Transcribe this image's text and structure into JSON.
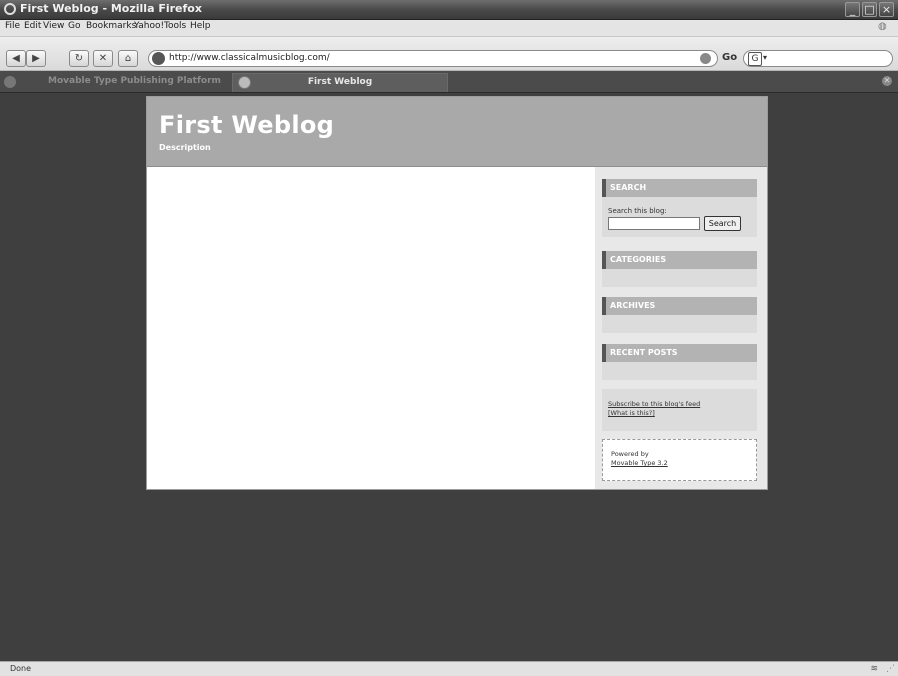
{
  "window": {
    "title": "First Weblog - Mozilla Firefox"
  },
  "menu": [
    "File",
    "Edit",
    "View",
    "Go",
    "Bookmarks",
    "Yahoo!",
    "Tools",
    "Help"
  ],
  "nav": {
    "url": "http://www.classicalmusicblog.com/",
    "go_label": "Go",
    "search_engine": "G"
  },
  "tabs": [
    {
      "label": "Movable Type Publishing Platform",
      "active": false
    },
    {
      "label": "First Weblog",
      "active": true
    }
  ],
  "blog": {
    "title": "First Weblog",
    "description": "Description",
    "sidebar": {
      "search_header": "SEARCH",
      "search_label": "Search this blog:",
      "search_button": "Search",
      "categories_header": "CATEGORIES",
      "archives_header": "ARCHIVES",
      "recent_header": "RECENT POSTS",
      "subscribe_link": "Subscribe to this blog's feed",
      "what_link": "[What is this?]",
      "powered_by": "Powered by",
      "powered_link": "Movable Type 3.2"
    }
  },
  "status": {
    "text": "Done"
  },
  "colors": {
    "background": "#3f3f3f",
    "banner": "#a9a9a9",
    "sidebar_header": "#b3b3b3"
  }
}
